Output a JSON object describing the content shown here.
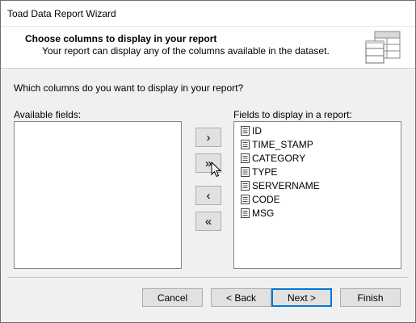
{
  "window": {
    "title": "Toad Data Report Wizard"
  },
  "header": {
    "title": "Choose columns to display in your report",
    "subtitle": "Your report can display any of the columns available in the dataset."
  },
  "question": "Which columns do you want to display in your report?",
  "available": {
    "label": "Available fields:",
    "items": []
  },
  "display": {
    "label": "Fields to display in a report:",
    "items": [
      {
        "name": "ID"
      },
      {
        "name": "TIME_STAMP"
      },
      {
        "name": "CATEGORY"
      },
      {
        "name": "TYPE"
      },
      {
        "name": "SERVERNAME"
      },
      {
        "name": "CODE"
      },
      {
        "name": "MSG"
      }
    ]
  },
  "move_buttons": {
    "add": "›",
    "add_all": "»",
    "remove": "‹",
    "remove_all": "«"
  },
  "buttons": {
    "cancel": "Cancel",
    "back": "< Back",
    "next": "Next >",
    "finish": "Finish"
  },
  "icons": {
    "header_art": "grid-table-icon",
    "field": "field-column-icon",
    "cursor": "mouse-pointer-icon"
  },
  "colors": {
    "default_button_border": "#0078d7",
    "header_background": "#ffffff",
    "dialog_background": "#f0f0f0"
  }
}
